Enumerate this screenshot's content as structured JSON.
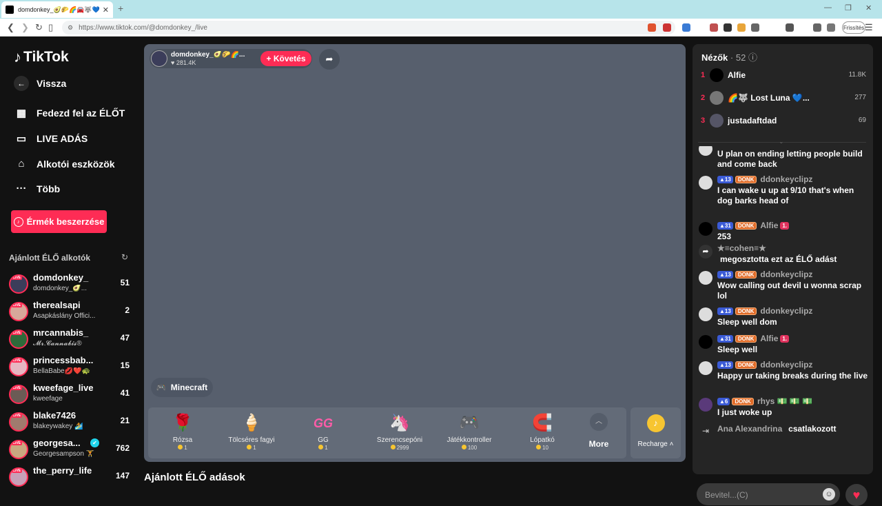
{
  "browser": {
    "tab_title": "⁡domdonkey_🥑🌮🌈🚘🐺💙",
    "url": "https://www.tiktok.com/@domdonkey_/live",
    "update_label": "Frissítés"
  },
  "sidebar": {
    "logo": "TikTok",
    "back": "Vissza",
    "nav": [
      "Fedezd fel az ÉLŐT",
      "LIVE ADÁS",
      "Alkotói eszközök",
      "Több"
    ],
    "coins_button": "Érmék beszerzése",
    "suggested_header": "Ajánlott ÉLŐ alkotók",
    "creators": [
      {
        "name": "domdonkey_",
        "sub": "⁡domdonkey_🥑...",
        "count": "51"
      },
      {
        "name": "therealsapi",
        "sub": "Asapkáslány Offici...",
        "count": "2"
      },
      {
        "name": "mrcannabis_",
        "sub": "𝓜𝓻.𝓒𝓪𝓷𝓷𝓪𝓫𝓲𝓼®",
        "count": "47"
      },
      {
        "name": "princessbab...",
        "sub": "BellaBabe💋❤️🐢",
        "count": "15"
      },
      {
        "name": "kweefage_live",
        "sub": "kweefage",
        "count": "41"
      },
      {
        "name": "blake7426",
        "sub": "blakeywakey 🏄",
        "count": "21"
      },
      {
        "name": "georgesa...",
        "sub": "Georgesampson 🏋",
        "count": "762"
      },
      {
        "name": "the_perry_life",
        "sub": "",
        "count": "147"
      }
    ]
  },
  "stream": {
    "host_name": "⁡domdonkey_🥑🌮🌈...",
    "host_likes": "281.4K",
    "follow_label": "+ Követés",
    "game_tag": "Minecraft",
    "gifts": [
      {
        "icon": "🌹",
        "name": "Rózsa",
        "price": "1"
      },
      {
        "icon": "🍦",
        "name": "Tölcséres fagyi",
        "price": "1"
      },
      {
        "icon": "GG",
        "name": "GG",
        "price": "1"
      },
      {
        "icon": "🦄",
        "name": "Szerencsepóni",
        "price": "2999"
      },
      {
        "icon": "🎮",
        "name": "Játékkontroller",
        "price": "100"
      },
      {
        "icon": "🧲",
        "name": "Lópatkó",
        "price": "10"
      }
    ],
    "more_label": "More",
    "recharge_label": "Recharge",
    "recommended_title": "Ajánlott ÉLŐ adások"
  },
  "viewers": {
    "title": "Nézők",
    "count": "· 52",
    "top": [
      {
        "rank": "1",
        "name": "Alfie⁡",
        "count": "11.8K"
      },
      {
        "rank": "2",
        "name": "🌈🐺⁡ Lost Luna 💙...",
        "count": "277"
      },
      {
        "rank": "3",
        "name": "justadaftdad",
        "count": "69"
      }
    ]
  },
  "chat": {
    "messages": [
      {
        "lvl": "",
        "team": "",
        "user": "",
        "text": "U plan on ending letting people build and come back"
      },
      {
        "lvl": "13",
        "team": "DONK",
        "user": "ddonkeyclipz ⁡",
        "text": "I can wake u up at 9/10 that's when dog barks head of"
      },
      {
        "lvl": "31",
        "team": "DONK",
        "user": "Alfie⁡",
        "rank": "1.",
        "text": "253"
      },
      {
        "lvl": "",
        "team": "",
        "user": "★≡cohen≡★",
        "text": "megosztotta ezt az ÉLŐ adást"
      },
      {
        "lvl": "13",
        "team": "DONK",
        "user": "ddonkeyclipz ⁡",
        "text": "Wow calling out devil u wonna scrap lol"
      },
      {
        "lvl": "13",
        "team": "DONK",
        "user": "ddonkeyclipz ⁡",
        "text": "Sleep well dom"
      },
      {
        "lvl": "31",
        "team": "DONK",
        "user": "Alfie⁡",
        "rank": "1.",
        "text": "Sleep well ⁡"
      },
      {
        "lvl": "13",
        "team": "DONK",
        "user": "ddonkeyclipz ⁡",
        "text": "Happy ur taking breaks during the live"
      },
      {
        "lvl": "6",
        "team": "DONK",
        "user": "rhys 💵 💵 💵",
        "text": "I just woke up"
      },
      {
        "lvl": "",
        "team": "",
        "user": "Ana Alexandrina",
        "text": "csatlakozott"
      }
    ],
    "input_placeholder": "Bevitel...(C)"
  }
}
